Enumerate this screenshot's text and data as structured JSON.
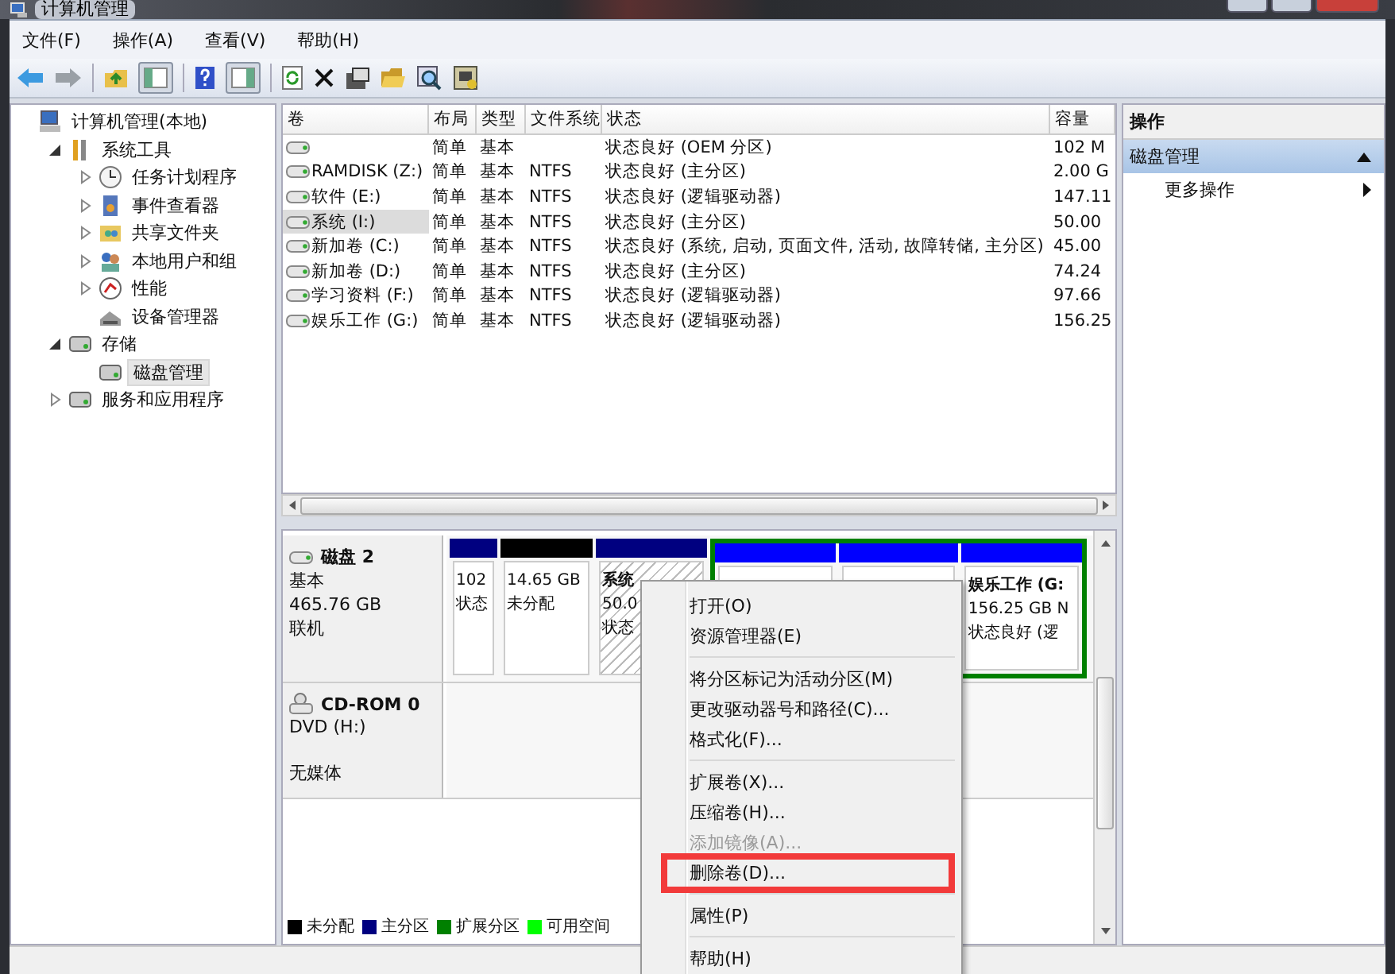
{
  "window": {
    "title": "计算机管理"
  },
  "menu": [
    "文件(F)",
    "操作(A)",
    "查看(V)",
    "帮助(H)"
  ],
  "tree": [
    {
      "label": "计算机管理(本地)",
      "selected": false,
      "children": [
        {
          "label": "系统工具",
          "expanded": true,
          "selected": false,
          "children": [
            {
              "label": "任务计划程序",
              "expanded": false,
              "selected": false
            },
            {
              "label": "事件查看器",
              "expanded": false,
              "selected": false
            },
            {
              "label": "共享文件夹",
              "expanded": false,
              "selected": false
            },
            {
              "label": "本地用户和组",
              "expanded": false,
              "selected": false
            },
            {
              "label": "性能",
              "expanded": false,
              "selected": false
            },
            {
              "label": "设备管理器",
              "selected": false
            }
          ]
        },
        {
          "label": "存储",
          "expanded": true,
          "selected": false,
          "children": [
            {
              "label": "磁盘管理",
              "selected": true
            }
          ]
        },
        {
          "label": "服务和应用程序",
          "expanded": false,
          "selected": false
        }
      ]
    }
  ],
  "table": {
    "columns": [
      "卷",
      "布局",
      "类型",
      "文件系统",
      "状态",
      "容量"
    ],
    "rows": [
      {
        "cells": [
          "",
          "简单",
          "基本",
          "",
          "状态良好 (OEM 分区)",
          "102 M"
        ],
        "selected": false
      },
      {
        "cells": [
          "RAMDISK (Z:)",
          "简单",
          "基本",
          "NTFS",
          "状态良好 (主分区)",
          "2.00 G"
        ],
        "selected": false
      },
      {
        "cells": [
          "软件 (E:)",
          "简单",
          "基本",
          "NTFS",
          "状态良好 (逻辑驱动器)",
          "147.11"
        ],
        "selected": false
      },
      {
        "cells": [
          "系统 (I:)",
          "简单",
          "基本",
          "NTFS",
          "状态良好 (主分区)",
          "50.00"
        ],
        "selected": true
      },
      {
        "cells": [
          "新加卷 (C:)",
          "简单",
          "基本",
          "NTFS",
          "状态良好 (系统, 启动, 页面文件, 活动, 故障转储, 主分区)",
          "45.00"
        ],
        "selected": false
      },
      {
        "cells": [
          "新加卷 (D:)",
          "简单",
          "基本",
          "NTFS",
          "状态良好 (主分区)",
          "74.24"
        ],
        "selected": false
      },
      {
        "cells": [
          "学习资料 (F:)",
          "简单",
          "基本",
          "NTFS",
          "状态良好 (逻辑驱动器)",
          "97.66"
        ],
        "selected": false
      },
      {
        "cells": [
          "娱乐工作 (G:)",
          "简单",
          "基本",
          "NTFS",
          "状态良好 (逻辑驱动器)",
          "156.25"
        ],
        "selected": false
      }
    ]
  },
  "disks": [
    {
      "kind": "disk",
      "name": "磁盘 2",
      "lines": [
        "基本",
        "465.76 GB",
        "联机"
      ],
      "partitions": [
        {
          "kind": "primary",
          "lines": [
            "102",
            "状态"
          ],
          "selected": false
        },
        {
          "kind": "unallocated",
          "lines": [
            "14.65 GB",
            "未分配"
          ],
          "selected": false
        },
        {
          "kind": "primary",
          "label": "系统",
          "lines": [
            "50.0",
            "状态"
          ],
          "selected": true
        },
        {
          "kind": "extended",
          "children": [
            {
              "kind": "logical",
              "selected": false
            },
            {
              "kind": "logical",
              "selected": false
            },
            {
              "kind": "logical",
              "label": "娱乐工作 (G:",
              "lines": [
                "156.25 GB N",
                "状态良好 (逻"
              ],
              "selected": false
            }
          ]
        }
      ]
    },
    {
      "kind": "cdrom",
      "name": "CD-ROM 0",
      "lines": [
        "DVD (H:)",
        "无媒体"
      ]
    }
  ],
  "legend": [
    {
      "label": "未分配",
      "color": "#000000"
    },
    {
      "label": "主分区",
      "color": "#000080"
    },
    {
      "label": "扩展分区",
      "color": "#008000"
    },
    {
      "label": "可用空间",
      "color": "#00ff00"
    }
  ],
  "actions": {
    "title": "操作",
    "section": {
      "label": "磁盘管理",
      "expanded": true
    },
    "items": [
      {
        "label": "更多操作"
      }
    ]
  },
  "context_menu": [
    {
      "kind": "item",
      "label": "打开(O)",
      "disabled": false
    },
    {
      "kind": "item",
      "label": "资源管理器(E)",
      "disabled": false
    },
    {
      "kind": "separator"
    },
    {
      "kind": "item",
      "label": "将分区标记为活动分区(M)",
      "disabled": false
    },
    {
      "kind": "item",
      "label": "更改驱动器号和路径(C)...",
      "disabled": false
    },
    {
      "kind": "item",
      "label": "格式化(F)...",
      "disabled": false
    },
    {
      "kind": "separator"
    },
    {
      "kind": "item",
      "label": "扩展卷(X)...",
      "disabled": false
    },
    {
      "kind": "item",
      "label": "压缩卷(H)...",
      "disabled": false
    },
    {
      "kind": "item",
      "label": "添加镜像(A)...",
      "disabled": true
    },
    {
      "kind": "item",
      "label": "删除卷(D)...",
      "disabled": false,
      "highlighted": true
    },
    {
      "kind": "separator"
    },
    {
      "kind": "item",
      "label": "属性(P)",
      "disabled": false
    },
    {
      "kind": "separator"
    },
    {
      "kind": "item",
      "label": "帮助(H)",
      "disabled": false
    }
  ]
}
